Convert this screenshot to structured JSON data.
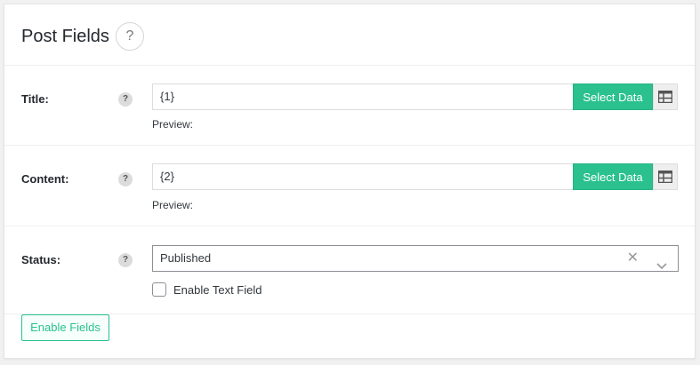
{
  "panel": {
    "title": "Post Fields",
    "help_glyph": "?"
  },
  "fields": [
    {
      "label": "Title:",
      "help_glyph": "?",
      "value": "{1}",
      "select_label": "Select Data",
      "preview_label": "Preview:",
      "table_icon": "table-icon"
    },
    {
      "label": "Content:",
      "help_glyph": "?",
      "value": "{2}",
      "select_label": "Select Data",
      "preview_label": "Preview:",
      "table_icon": "table-icon"
    }
  ],
  "status": {
    "label": "Status:",
    "help_glyph": "?",
    "selected": "Published",
    "clear_glyph": "✕",
    "checkbox_label": "Enable Text Field",
    "checkbox_checked": false
  },
  "footer": {
    "enable_fields_label": "Enable Fields"
  },
  "colors": {
    "accent": "#2bc18f",
    "panel_bg": "#ffffff",
    "page_bg": "#f1f1f1"
  }
}
